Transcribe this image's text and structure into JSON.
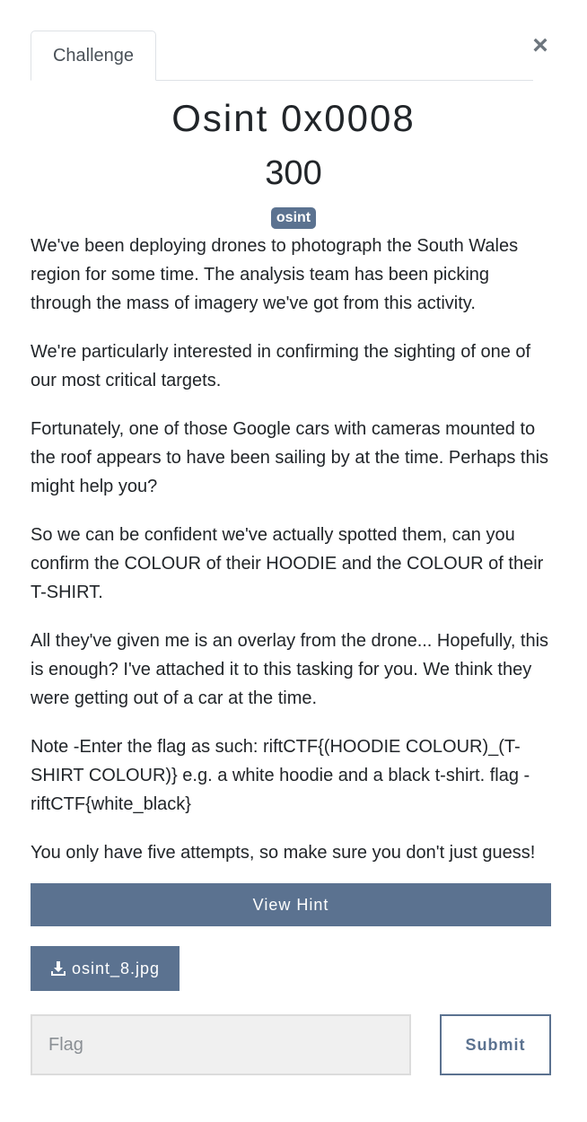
{
  "tab": {
    "label": "Challenge"
  },
  "close": {
    "label": "×",
    "icon": "close-icon"
  },
  "challenge": {
    "name": "Osint 0x0008",
    "points": "300",
    "tag": "osint",
    "description": [
      "We've been deploying drones to photograph the South Wales region for some time. The analysis team has been picking through the mass of imagery we've got from this activity.",
      "We're particularly interested in confirming the sighting of one of our most critical targets.",
      "Fortunately, one of those Google cars with cameras mounted to the roof appears to have been sailing by at the time. Perhaps this might help you?",
      "So we can be confident we've actually spotted them, can you confirm the COLOUR of their HOODIE and the COLOUR of their T-SHIRT.",
      "All they've given me is an overlay from the drone... Hopefully, this is enough? I've attached it to this tasking for you. We think they were getting out of a car at the time.",
      "Note -Enter the flag as such: riftCTF{(HOODIE COLOUR)_(T-SHIRT COLOUR)} e.g. a white hoodie and a black t-shirt. flag - riftCTF{white_black}",
      "You only have five attempts, so make sure you don't just guess!"
    ]
  },
  "hint": {
    "label": "View Hint"
  },
  "file": {
    "label": "osint_8.jpg",
    "icon": "download-icon"
  },
  "flag": {
    "placeholder": "Flag",
    "value": ""
  },
  "submit": {
    "label": "Submit"
  },
  "colors": {
    "accent": "#5b7290",
    "text": "#212529",
    "input_bg": "#f0f0f0"
  }
}
